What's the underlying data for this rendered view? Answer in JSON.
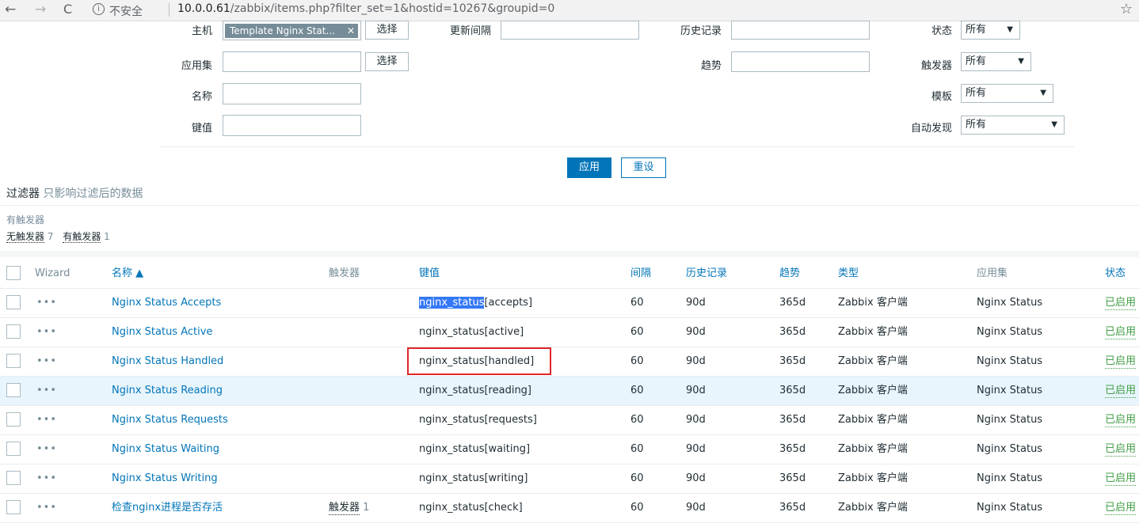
{
  "browser": {
    "back_icon": "←",
    "forward_icon": "→",
    "reload_icon": "C",
    "info_icon": "i",
    "security_text": "不安全",
    "url_host": "10.0.0.61",
    "url_path": "/zabbix/items.php?filter_set=1&hostid=10267&groupid=0",
    "star_icon": "☆"
  },
  "filter": {
    "host_label": "主机",
    "host_chip": "Template Nginx Stat...",
    "host_chip_close": "✕",
    "select_label": "选择",
    "update_interval_label": "更新间隔",
    "history_label": "历史记录",
    "state_label": "状态",
    "state_value": "所有",
    "app_label": "应用集",
    "app_select_label": "选择",
    "trend_label": "趋势",
    "trigger_label": "触发器",
    "trigger_value": "所有",
    "name_label": "名称",
    "template_label": "模板",
    "template_value": "所有",
    "key_label": "键值",
    "discovery_label": "自动发现",
    "discovery_value": "所有",
    "apply_label": "应用",
    "reset_label": "重设",
    "title": "过滤器",
    "title_sub": "只影响过滤后的数据"
  },
  "subfilter": {
    "title": "有触发器",
    "items": [
      {
        "label": "无触发器",
        "count": "7"
      },
      {
        "label": "有触发器",
        "count": "1"
      }
    ]
  },
  "table": {
    "headers": {
      "wizard": "Wizard",
      "name": "名称 ▲",
      "triggers": "触发器",
      "key": "键值",
      "interval": "间隔",
      "history": "历史记录",
      "trends": "趋势",
      "type": "类型",
      "applications": "应用集",
      "status": "状态"
    },
    "rows": [
      {
        "wizard": "•••",
        "name": "Nginx Status Accepts",
        "triggers": "",
        "trigger_count": "",
        "key_hl": "nginx_status",
        "key_rest": "[accepts]",
        "interval": "60",
        "history": "90d",
        "trends": "365d",
        "type": "Zabbix 客户端",
        "app": "Nginx Status",
        "status": "已启用"
      },
      {
        "wizard": "•••",
        "name": "Nginx Status Active",
        "triggers": "",
        "trigger_count": "",
        "key_hl": "",
        "key_rest": "nginx_status[active]",
        "interval": "60",
        "history": "90d",
        "trends": "365d",
        "type": "Zabbix 客户端",
        "app": "Nginx Status",
        "status": "已启用"
      },
      {
        "wizard": "•••",
        "name": "Nginx Status Handled",
        "triggers": "",
        "trigger_count": "",
        "key_hl": "",
        "key_rest": "nginx_status[handled]",
        "interval": "60",
        "history": "90d",
        "trends": "365d",
        "type": "Zabbix 客户端",
        "app": "Nginx Status",
        "status": "已启用"
      },
      {
        "wizard": "•••",
        "name": "Nginx Status Reading",
        "triggers": "",
        "trigger_count": "",
        "key_hl": "",
        "key_rest": "nginx_status[reading]",
        "interval": "60",
        "history": "90d",
        "trends": "365d",
        "type": "Zabbix 客户端",
        "app": "Nginx Status",
        "status": "已启用"
      },
      {
        "wizard": "•••",
        "name": "Nginx Status Requests",
        "triggers": "",
        "trigger_count": "",
        "key_hl": "",
        "key_rest": "nginx_status[requests]",
        "interval": "60",
        "history": "90d",
        "trends": "365d",
        "type": "Zabbix 客户端",
        "app": "Nginx Status",
        "status": "已启用"
      },
      {
        "wizard": "•••",
        "name": "Nginx Status Waiting",
        "triggers": "",
        "trigger_count": "",
        "key_hl": "",
        "key_rest": "nginx_status[waiting]",
        "interval": "60",
        "history": "90d",
        "trends": "365d",
        "type": "Zabbix 客户端",
        "app": "Nginx Status",
        "status": "已启用"
      },
      {
        "wizard": "•••",
        "name": "Nginx Status Writing",
        "triggers": "",
        "trigger_count": "",
        "key_hl": "",
        "key_rest": "nginx_status[writing]",
        "interval": "60",
        "history": "90d",
        "trends": "365d",
        "type": "Zabbix 客户端",
        "app": "Nginx Status",
        "status": "已启用"
      },
      {
        "wizard": "•••",
        "name": "检查nginx进程是否存活",
        "triggers": "触发器",
        "trigger_count": "1",
        "key_hl": "",
        "key_rest": "nginx_status[check]",
        "interval": "60",
        "history": "90d",
        "trends": "365d",
        "type": "Zabbix 客户端",
        "app": "Nginx Status",
        "status": "已启用"
      }
    ]
  },
  "colors": {
    "accent": "#0275b8",
    "enabled": "#429e47",
    "highlight_box": "#e0262b"
  }
}
